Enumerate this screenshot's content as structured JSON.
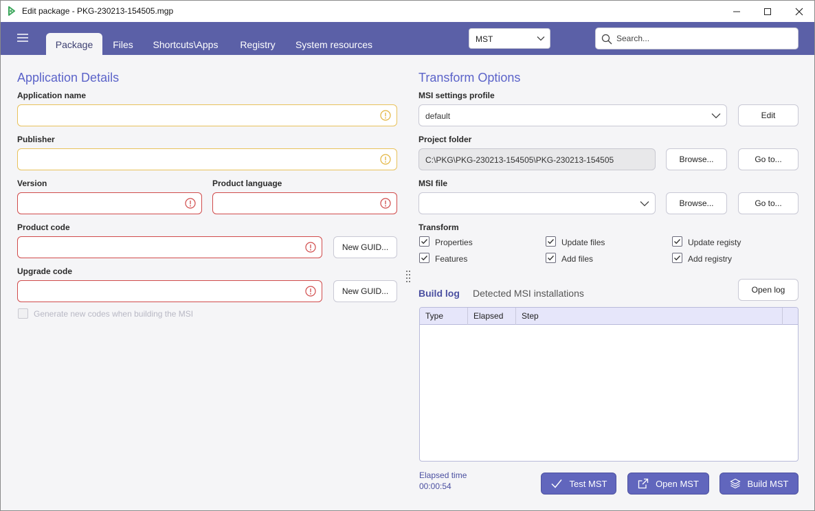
{
  "window": {
    "title": "Edit package - PKG-230213-154505.mgp"
  },
  "navbar": {
    "tabs": [
      {
        "label": "Package"
      },
      {
        "label": "Files"
      },
      {
        "label": "Shortcuts\\Apps"
      },
      {
        "label": "Registry"
      },
      {
        "label": "System resources"
      }
    ],
    "active_tab": "Package",
    "mode_select": {
      "value": "MST"
    },
    "search": {
      "placeholder": "Search..."
    }
  },
  "app_details": {
    "title": "Application Details",
    "app_name_label": "Application name",
    "app_name_value": "",
    "publisher_label": "Publisher",
    "publisher_value": "",
    "version_label": "Version",
    "version_value": "",
    "product_language_label": "Product language",
    "product_language_value": "",
    "product_code_label": "Product code",
    "product_code_value": "",
    "new_guid_label": "New GUID...",
    "upgrade_code_label": "Upgrade code",
    "upgrade_code_value": "",
    "generate_codes_label": "Generate new codes when building the MSI",
    "generate_codes_checked": false
  },
  "transform_options": {
    "title": "Transform Options",
    "msi_profile_label": "MSI settings profile",
    "msi_profile_value": "default",
    "edit_label": "Edit",
    "project_folder_label": "Project folder",
    "project_folder_value": "C:\\PKG\\PKG-230213-154505\\PKG-230213-154505",
    "browse_label": "Browse...",
    "goto_label": "Go to...",
    "msi_file_label": "MSI file",
    "msi_file_value": "",
    "transform_label": "Transform",
    "checks": [
      {
        "label": "Properties",
        "checked": true
      },
      {
        "label": "Update files",
        "checked": true
      },
      {
        "label": "Update registy",
        "checked": true
      },
      {
        "label": "Features",
        "checked": true
      },
      {
        "label": "Add files",
        "checked": true
      },
      {
        "label": "Add registry",
        "checked": true
      }
    ]
  },
  "build_log": {
    "tabs": [
      {
        "label": "Build log",
        "active": true
      },
      {
        "label": "Detected MSI installations",
        "active": false
      }
    ],
    "open_log_label": "Open log",
    "columns": [
      "Type",
      "Elapsed",
      "Step"
    ],
    "rows": []
  },
  "footer": {
    "elapsed_label": "Elapsed time",
    "elapsed_value": "00:00:54",
    "test_label": "Test MST",
    "open_label": "Open MST",
    "build_label": "Build MST"
  },
  "colors": {
    "nav_bg": "#5b60a7",
    "accent": "#5b63c9",
    "warn": "#e8c15a",
    "error": "#d04a4a",
    "primary_button": "#6166bd"
  }
}
